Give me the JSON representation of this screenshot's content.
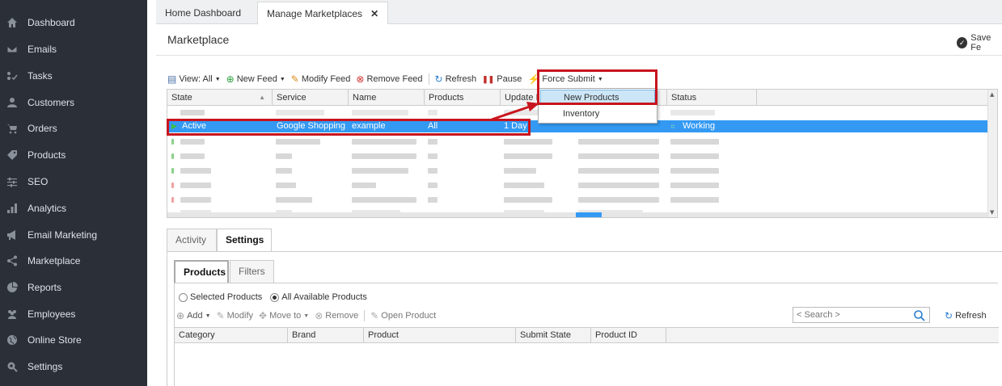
{
  "sidebar": {
    "items": [
      {
        "label": "Dashboard",
        "icon": "home-icon"
      },
      {
        "label": "Emails",
        "icon": "envelope-icon"
      },
      {
        "label": "Tasks",
        "icon": "tasks-icon"
      },
      {
        "label": "Customers",
        "icon": "user-icon"
      },
      {
        "label": "Orders",
        "icon": "cart-icon"
      },
      {
        "label": "Products",
        "icon": "tag-icon"
      },
      {
        "label": "SEO",
        "icon": "sliders-icon"
      },
      {
        "label": "Analytics",
        "icon": "bar-chart-icon"
      },
      {
        "label": "Email Marketing",
        "icon": "megaphone-icon"
      },
      {
        "label": "Marketplace",
        "icon": "share-icon"
      },
      {
        "label": "Reports",
        "icon": "pie-chart-icon"
      },
      {
        "label": "Employees",
        "icon": "users-icon"
      },
      {
        "label": "Online Store",
        "icon": "globe-icon"
      },
      {
        "label": "Settings",
        "icon": "gear-icon"
      }
    ]
  },
  "tabs": [
    {
      "label": "Home Dashboard"
    },
    {
      "label": "Manage Marketplaces",
      "close": "✕"
    }
  ],
  "page": {
    "title": "Marketplace",
    "save_label": "Save Fe"
  },
  "toolbar": {
    "view": "View: All",
    "new_feed": "New Feed",
    "modify_feed": "Modify Feed",
    "remove_feed": "Remove Feed",
    "refresh": "Refresh",
    "pause": "Pause",
    "force_submit": "Force Submit"
  },
  "dropdown": {
    "items": [
      "New Products",
      "Inventory"
    ]
  },
  "grid": {
    "columns": [
      "State",
      "Service",
      "Name",
      "Products",
      "Update I",
      "Status"
    ],
    "selected_row": {
      "state": "Active",
      "service": "Google Shopping",
      "name": "example",
      "products": "All",
      "update": "1 Day",
      "status": "Working"
    }
  },
  "bottom_tabs": [
    "Activity",
    "Settings"
  ],
  "sub_tabs": [
    "Products",
    "Filters"
  ],
  "radios": {
    "selected_products": "Selected Products",
    "all_available": "All Available Products"
  },
  "product_toolbar": {
    "add": "Add",
    "modify": "Modify",
    "move_to": "Move to",
    "remove": "Remove",
    "open_product": "Open Product",
    "search_placeholder": "< Search >",
    "refresh": "Refresh"
  },
  "product_grid": {
    "columns": [
      "Category",
      "Brand",
      "Product",
      "Submit State",
      "Product ID"
    ]
  },
  "colors": {
    "sidebar_bg": "#2b2f38",
    "selection": "#3399f3",
    "highlight_red": "#c8141e"
  }
}
